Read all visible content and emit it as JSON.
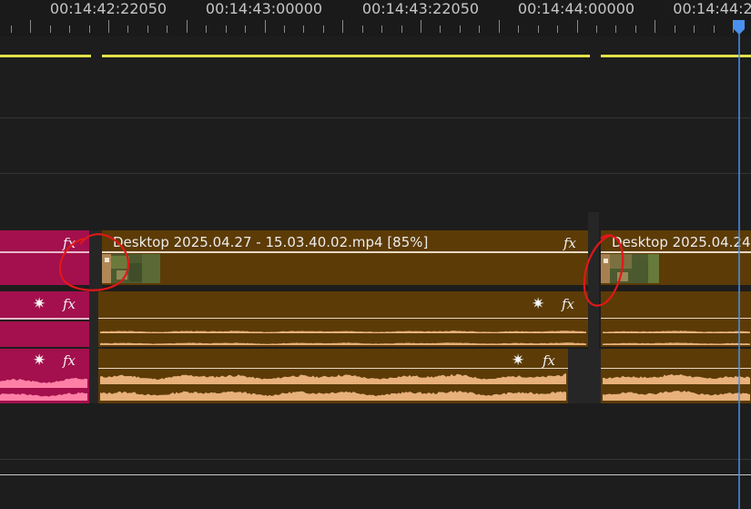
{
  "ruler": {
    "timecodes": [
      "00:14:42:22050",
      "00:14:43:00000",
      "00:14:43:22050",
      "00:14:44:00000",
      "00:14:44:2"
    ]
  },
  "video_track": {
    "clip_main_title": "Desktop 2025.04.27 - 15.03.40.02.mp4 [85%]",
    "clip_next_title": "Desktop 2025.04.24",
    "fx_glyph": "fx"
  },
  "audio_tracks": {
    "fx_glyph": "fx",
    "keyframe_glyph": "✷"
  },
  "colors": {
    "clip_gold": "#5c3b06",
    "clip_pink": "#a3104d",
    "waveform": "#e8b07a",
    "waveform_pink": "#ff80a6",
    "work_area": "#e3e148",
    "playhead": "#4a90ee",
    "annotation": "#e01818"
  },
  "icons": {
    "fx": "fx-badge-icon",
    "keyframe": "keyframe-star-icon",
    "playhead": "playhead-marker-icon"
  }
}
